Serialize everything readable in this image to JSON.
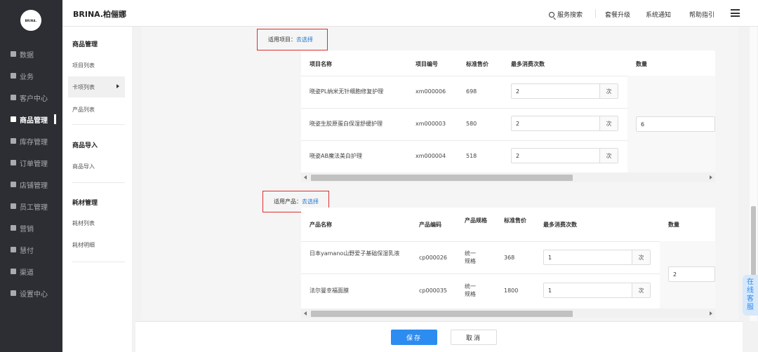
{
  "logo": {
    "text": "BRINA."
  },
  "leftnav": {
    "items": [
      {
        "label": "数据"
      },
      {
        "label": "业务"
      },
      {
        "label": "客户中心"
      },
      {
        "label": "商品管理"
      },
      {
        "label": "库存管理"
      },
      {
        "label": "订单管理"
      },
      {
        "label": "店铺管理"
      },
      {
        "label": "员工管理"
      },
      {
        "label": "营销"
      },
      {
        "label": "慧付"
      },
      {
        "label": "渠道"
      },
      {
        "label": "设置中心"
      }
    ],
    "active": "商品管理"
  },
  "header": {
    "brand": "BRINA.柏俪娜",
    "search": "服务搜索",
    "upgrade": "套餐升级",
    "notice": "系统通知",
    "help": "帮助指引"
  },
  "subnav": {
    "group1": {
      "title": "商品管理",
      "items": [
        "项目列表",
        "卡项列表",
        "产品列表"
      ]
    },
    "group2": {
      "title": "商品导入",
      "items": [
        "商品导入"
      ]
    },
    "group3": {
      "title": "耗材管理",
      "items": [
        "耗材列表",
        "耗材明细"
      ]
    },
    "active": "卡项列表"
  },
  "projects": {
    "label": "适用项目：",
    "link": "去选择",
    "headers": [
      "项目名称",
      "项目编号",
      "标准售价",
      "最多消费次数",
      "数量"
    ],
    "rows": [
      {
        "name": "晓姿PL纳米无针细胞修复护理",
        "code": "xm000006",
        "price": "698",
        "times": "2",
        "unit": "次"
      },
      {
        "name": "晓姿生胶原蛋白保湿舒缓护理",
        "code": "xm000003",
        "price": "580",
        "times": "2",
        "unit": "次"
      },
      {
        "name": "晓姿AB魔法美白护理",
        "code": "xm000004",
        "price": "518",
        "times": "2",
        "unit": "次"
      }
    ],
    "quantity": "6"
  },
  "products": {
    "label": "适用产品：",
    "link": "去选择",
    "headers": [
      "产品名称",
      "产品编码",
      "产品规格",
      "标准售价",
      "最多消费次数",
      "数量"
    ],
    "rows": [
      {
        "name": "日本yamano山野爱子基础保湿乳液",
        "code": "cp000026",
        "spec": "统一规格",
        "price": "368",
        "times": "1",
        "unit": "次"
      },
      {
        "name": "法尔曼幸福面膜",
        "code": "cp000035",
        "spec": "统一规格",
        "price": "1800",
        "times": "1",
        "unit": "次"
      }
    ],
    "quantity": "2"
  },
  "footer": {
    "save": "保存",
    "cancel": "取消"
  },
  "service_widget": {
    "label": "在线客服"
  },
  "colors": {
    "primary": "#2d8cf0",
    "highlight_border": "#e02d2d",
    "sidebar_bg": "#2c2e33"
  }
}
